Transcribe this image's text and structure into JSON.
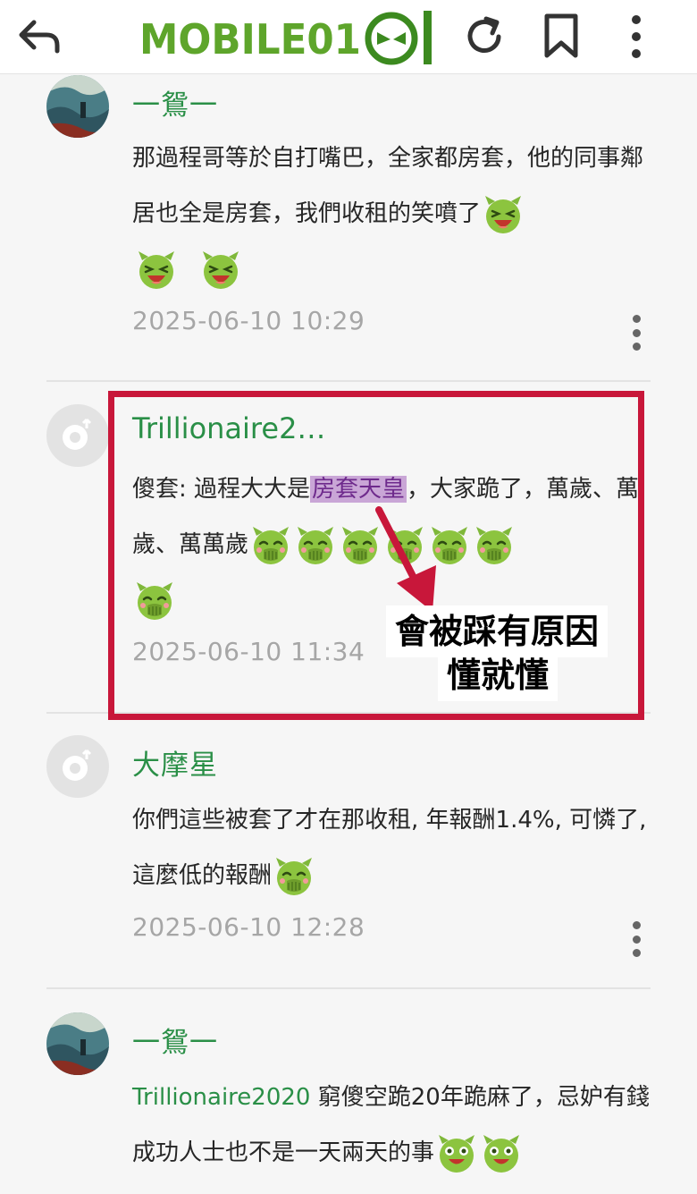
{
  "topbar": {
    "logo_text": "MOBILE01",
    "icons": [
      "back-arrow-icon",
      "refresh-icon",
      "bookmark-icon",
      "more-vertical-icon"
    ]
  },
  "comments": [
    {
      "username": "一鴛一",
      "body_text": "那過程哥等於自打嘴巴，全家都房套，他的同事鄰居也全是房套，我們收租的笑噴了",
      "emoji": [
        "laughing-emoji",
        "laughing-emoji",
        "laughing-emoji"
      ],
      "time": "2025-06-10 10:29"
    },
    {
      "username": "Trillionaire2…",
      "body_prefix": "傻套: 過程大大是",
      "body_highlight": "房套天皇",
      "body_suffix": "，大家跪了，萬歲、萬歲、萬萬歲",
      "emoji": [
        "snicker-emoji",
        "snicker-emoji",
        "snicker-emoji",
        "snicker-emoji",
        "snicker-emoji",
        "snicker-emoji",
        "snicker-emoji"
      ],
      "time": "2025-06-10 11:34"
    },
    {
      "username": "大摩星",
      "body_text": "你們這些被套了才在那收租, 年報酬1.4%, 可憐了, 這麼低的報酬",
      "emoji": [
        "snicker-emoji"
      ],
      "time": "2025-06-10 12:28"
    },
    {
      "username": "一鴛一",
      "mention": "Trillionaire2020",
      "body_text": " 窮傻空跪20年跪麻了，忌妒有錢成功人士也不是一天兩天的事",
      "emoji": [
        "grinning-emoji",
        "grinning-emoji"
      ]
    }
  ],
  "annotation": {
    "line1": "會被踩有原因",
    "line2": "懂就懂",
    "box_color": "#c8173a"
  },
  "colors": {
    "username_green": "#2a8f47",
    "timestamp_gray": "#a6a6a6",
    "highlight_purple": "#c9a6d6"
  }
}
